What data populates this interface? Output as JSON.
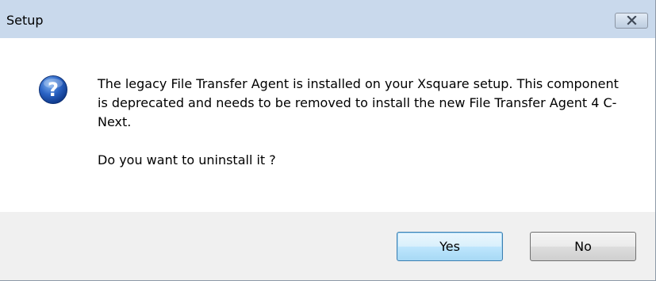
{
  "window": {
    "title": "Setup",
    "close_icon": "close-icon"
  },
  "message": {
    "icon": "question-icon",
    "body": "The legacy File Transfer Agent is installed on your Xsquare setup. This component is deprecated and needs to be removed to install the new File Transfer Agent 4 C-Next.",
    "question": "Do you want to uninstall it ?"
  },
  "buttons": {
    "yes_label": "Yes",
    "no_label": "No"
  },
  "colors": {
    "titlebar": "#c9d9ec",
    "icon_blue": "#1f57b5",
    "default_button_border": "#3c7fb1",
    "footer": "#f0f0f0"
  }
}
